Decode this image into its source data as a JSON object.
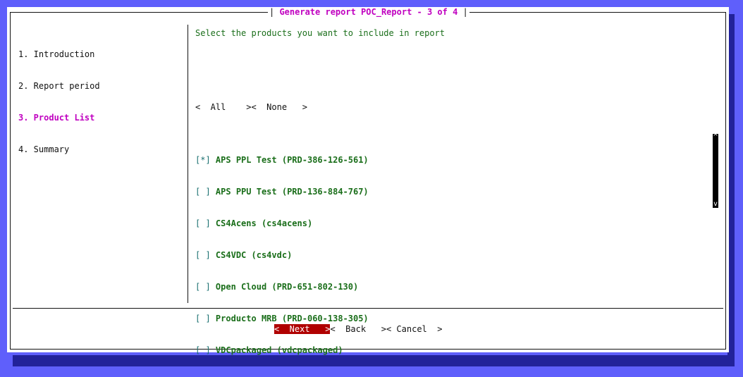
{
  "dialog": {
    "title_left": "| ",
    "title": "Generate report POC_Report - 3 of 4",
    "title_right": " |"
  },
  "steps": [
    {
      "label": "1. Introduction"
    },
    {
      "label": "2. Report period"
    },
    {
      "label": "3. Product List"
    },
    {
      "label": "4. Summary"
    }
  ],
  "main": {
    "prompt": "Select the products you want to include in report",
    "all_button": "<  All    >",
    "none_button": "<  None   >"
  },
  "products": [
    {
      "box": "[*]",
      "label": "APS PPL Test (PRD-386-126-561)"
    },
    {
      "box": "[ ]",
      "label": "APS PPU Test (PRD-136-884-767)"
    },
    {
      "box": "[ ]",
      "label": "CS4Acens (cs4acens)"
    },
    {
      "box": "[ ]",
      "label": "CS4VDC (cs4vdc)"
    },
    {
      "box": "[ ]",
      "label": "Open Cloud (PRD-651-802-130)"
    },
    {
      "box": "[ ]",
      "label": "Producto MRB (PRD-060-138-305)"
    },
    {
      "box": "[ ]",
      "label": "VDCpackaged (vdcpackaged)"
    }
  ],
  "scrollbar": {
    "up": "^",
    "down": "v"
  },
  "footer": {
    "next": "<  Next   >",
    "back": "<  Back   >",
    "cancel": "< Cancel  >"
  },
  "colors": {
    "background": "#5f5ffb",
    "accent": "#c000c0",
    "selected_button": "#b00000",
    "list_text": "#1a6e1a"
  }
}
